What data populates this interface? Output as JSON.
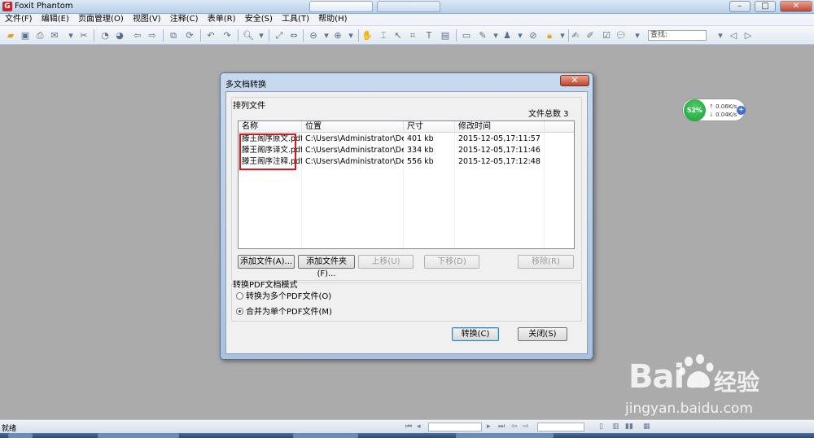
{
  "app": {
    "title": "Foxit Phantom"
  },
  "window_controls": {
    "minimize": "–",
    "maximize": "□",
    "close": "✕"
  },
  "menu": [
    "文件(F)",
    "编辑(E)",
    "页面管理(O)",
    "视图(V)",
    "注释(C)",
    "表单(R)",
    "安全(S)",
    "工具(T)",
    "帮助(H)"
  ],
  "toolbar": {
    "find_placeholder": "查找:"
  },
  "speed_widget": {
    "percent": "52%",
    "up": "0.06K/s",
    "down": "0.04K/s",
    "plus": "+"
  },
  "dialog": {
    "title": "多文档转换",
    "close_label": "✕",
    "list_group_label": "排列文件",
    "file_count": "文件总数 3",
    "columns": [
      "名称",
      "位置",
      "尺寸",
      "修改时间"
    ],
    "files": [
      {
        "name": "滕王阁序原文.pdf",
        "location": "C:\\Users\\Administrator\\De...",
        "size": "401 kb",
        "modified": "2015-12-05,17:11:57"
      },
      {
        "name": "滕王阁序译文.pdf",
        "location": "C:\\Users\\Administrator\\De...",
        "size": "334 kb",
        "modified": "2015-12-05,17:11:46"
      },
      {
        "name": "滕王阁序注释.pdf",
        "location": "C:\\Users\\Administrator\\De...",
        "size": "556 kb",
        "modified": "2015-12-05,17:12:48"
      }
    ],
    "buttons": {
      "add_file": "添加文件(A)...",
      "add_folder": "添加文件夹(F)...",
      "move_up": "上移(U)",
      "move_down": "下移(D)",
      "remove": "移除(R)",
      "convert": "转换(C)",
      "close": "关闭(S)"
    },
    "mode_group_label": "转换PDF文档模式",
    "mode_options": [
      {
        "label": "转换为多个PDF文件(O)",
        "checked": false
      },
      {
        "label": "合并为单个PDF文件(M)",
        "checked": true
      }
    ]
  },
  "status": {
    "text": "就绪"
  },
  "watermark": {
    "logo": "Bai",
    "text": "经验",
    "url": "jingyan.baidu.com"
  }
}
